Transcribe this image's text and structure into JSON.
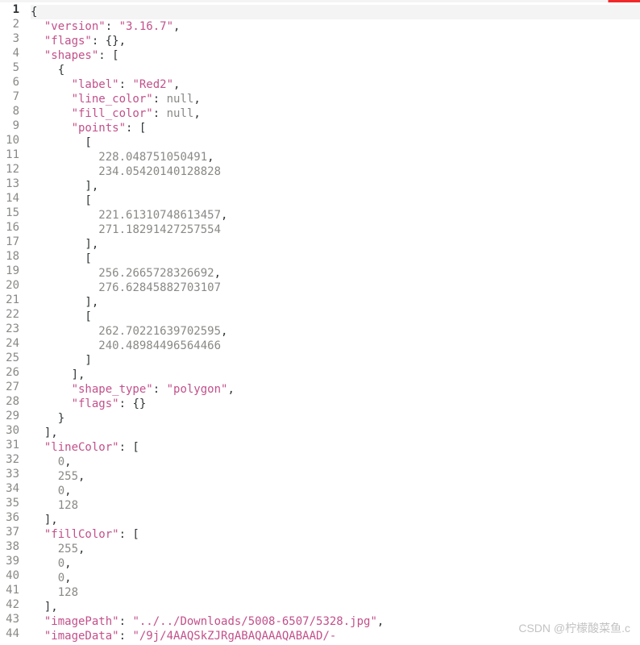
{
  "watermark": "CSDN @柠檬酸菜鱼.c",
  "lines": [
    {
      "n": 1,
      "cur": true,
      "tokens": [
        {
          "c": "p",
          "t": "{"
        }
      ]
    },
    {
      "n": 2,
      "tokens": [
        {
          "c": "p",
          "t": "  "
        },
        {
          "c": "k",
          "t": "\"version\""
        },
        {
          "c": "p",
          "t": ": "
        },
        {
          "c": "s",
          "t": "\"3.16.7\""
        },
        {
          "c": "p",
          "t": ","
        }
      ]
    },
    {
      "n": 3,
      "tokens": [
        {
          "c": "p",
          "t": "  "
        },
        {
          "c": "k",
          "t": "\"flags\""
        },
        {
          "c": "p",
          "t": ": {},"
        }
      ]
    },
    {
      "n": 4,
      "tokens": [
        {
          "c": "p",
          "t": "  "
        },
        {
          "c": "k",
          "t": "\"shapes\""
        },
        {
          "c": "p",
          "t": ": ["
        }
      ]
    },
    {
      "n": 5,
      "tokens": [
        {
          "c": "p",
          "t": "    {"
        }
      ]
    },
    {
      "n": 6,
      "tokens": [
        {
          "c": "p",
          "t": "      "
        },
        {
          "c": "k",
          "t": "\"label\""
        },
        {
          "c": "p",
          "t": ": "
        },
        {
          "c": "s",
          "t": "\"Red2\""
        },
        {
          "c": "p",
          "t": ","
        }
      ]
    },
    {
      "n": 7,
      "tokens": [
        {
          "c": "p",
          "t": "      "
        },
        {
          "c": "k",
          "t": "\"line_color\""
        },
        {
          "c": "p",
          "t": ": "
        },
        {
          "c": "n",
          "t": "null"
        },
        {
          "c": "p",
          "t": ","
        }
      ]
    },
    {
      "n": 8,
      "tokens": [
        {
          "c": "p",
          "t": "      "
        },
        {
          "c": "k",
          "t": "\"fill_color\""
        },
        {
          "c": "p",
          "t": ": "
        },
        {
          "c": "n",
          "t": "null"
        },
        {
          "c": "p",
          "t": ","
        }
      ]
    },
    {
      "n": 9,
      "tokens": [
        {
          "c": "p",
          "t": "      "
        },
        {
          "c": "k",
          "t": "\"points\""
        },
        {
          "c": "p",
          "t": ": ["
        }
      ]
    },
    {
      "n": 10,
      "tokens": [
        {
          "c": "p",
          "t": "        ["
        }
      ]
    },
    {
      "n": 11,
      "tokens": [
        {
          "c": "p",
          "t": "          "
        },
        {
          "c": "num",
          "t": "228.048751050491"
        },
        {
          "c": "p",
          "t": ","
        }
      ]
    },
    {
      "n": 12,
      "tokens": [
        {
          "c": "p",
          "t": "          "
        },
        {
          "c": "num",
          "t": "234.05420140128828"
        }
      ]
    },
    {
      "n": 13,
      "tokens": [
        {
          "c": "p",
          "t": "        ],"
        }
      ]
    },
    {
      "n": 14,
      "tokens": [
        {
          "c": "p",
          "t": "        ["
        }
      ]
    },
    {
      "n": 15,
      "tokens": [
        {
          "c": "p",
          "t": "          "
        },
        {
          "c": "num",
          "t": "221.61310748613457"
        },
        {
          "c": "p",
          "t": ","
        }
      ]
    },
    {
      "n": 16,
      "tokens": [
        {
          "c": "p",
          "t": "          "
        },
        {
          "c": "num",
          "t": "271.18291427257554"
        }
      ]
    },
    {
      "n": 17,
      "tokens": [
        {
          "c": "p",
          "t": "        ],"
        }
      ]
    },
    {
      "n": 18,
      "tokens": [
        {
          "c": "p",
          "t": "        ["
        }
      ]
    },
    {
      "n": 19,
      "tokens": [
        {
          "c": "p",
          "t": "          "
        },
        {
          "c": "num",
          "t": "256.2665728326692"
        },
        {
          "c": "p",
          "t": ","
        }
      ]
    },
    {
      "n": 20,
      "tokens": [
        {
          "c": "p",
          "t": "          "
        },
        {
          "c": "num",
          "t": "276.62845882703107"
        }
      ]
    },
    {
      "n": 21,
      "tokens": [
        {
          "c": "p",
          "t": "        ],"
        }
      ]
    },
    {
      "n": 22,
      "tokens": [
        {
          "c": "p",
          "t": "        ["
        }
      ]
    },
    {
      "n": 23,
      "tokens": [
        {
          "c": "p",
          "t": "          "
        },
        {
          "c": "num",
          "t": "262.70221639702595"
        },
        {
          "c": "p",
          "t": ","
        }
      ]
    },
    {
      "n": 24,
      "tokens": [
        {
          "c": "p",
          "t": "          "
        },
        {
          "c": "num",
          "t": "240.48984496564466"
        }
      ]
    },
    {
      "n": 25,
      "tokens": [
        {
          "c": "p",
          "t": "        ]"
        }
      ]
    },
    {
      "n": 26,
      "tokens": [
        {
          "c": "p",
          "t": "      ],"
        }
      ]
    },
    {
      "n": 27,
      "tokens": [
        {
          "c": "p",
          "t": "      "
        },
        {
          "c": "k",
          "t": "\"shape_type\""
        },
        {
          "c": "p",
          "t": ": "
        },
        {
          "c": "s",
          "t": "\"polygon\""
        },
        {
          "c": "p",
          "t": ","
        }
      ]
    },
    {
      "n": 28,
      "tokens": [
        {
          "c": "p",
          "t": "      "
        },
        {
          "c": "k",
          "t": "\"flags\""
        },
        {
          "c": "p",
          "t": ": {}"
        }
      ]
    },
    {
      "n": 29,
      "tokens": [
        {
          "c": "p",
          "t": "    }"
        }
      ]
    },
    {
      "n": 30,
      "tokens": [
        {
          "c": "p",
          "t": "  ],"
        }
      ]
    },
    {
      "n": 31,
      "tokens": [
        {
          "c": "p",
          "t": "  "
        },
        {
          "c": "k",
          "t": "\"lineColor\""
        },
        {
          "c": "p",
          "t": ": ["
        }
      ]
    },
    {
      "n": 32,
      "tokens": [
        {
          "c": "p",
          "t": "    "
        },
        {
          "c": "num",
          "t": "0"
        },
        {
          "c": "p",
          "t": ","
        }
      ]
    },
    {
      "n": 33,
      "tokens": [
        {
          "c": "p",
          "t": "    "
        },
        {
          "c": "num",
          "t": "255"
        },
        {
          "c": "p",
          "t": ","
        }
      ]
    },
    {
      "n": 34,
      "tokens": [
        {
          "c": "p",
          "t": "    "
        },
        {
          "c": "num",
          "t": "0"
        },
        {
          "c": "p",
          "t": ","
        }
      ]
    },
    {
      "n": 35,
      "tokens": [
        {
          "c": "p",
          "t": "    "
        },
        {
          "c": "num",
          "t": "128"
        }
      ]
    },
    {
      "n": 36,
      "tokens": [
        {
          "c": "p",
          "t": "  ],"
        }
      ]
    },
    {
      "n": 37,
      "tokens": [
        {
          "c": "p",
          "t": "  "
        },
        {
          "c": "k",
          "t": "\"fillColor\""
        },
        {
          "c": "p",
          "t": ": ["
        }
      ]
    },
    {
      "n": 38,
      "tokens": [
        {
          "c": "p",
          "t": "    "
        },
        {
          "c": "num",
          "t": "255"
        },
        {
          "c": "p",
          "t": ","
        }
      ]
    },
    {
      "n": 39,
      "tokens": [
        {
          "c": "p",
          "t": "    "
        },
        {
          "c": "num",
          "t": "0"
        },
        {
          "c": "p",
          "t": ","
        }
      ]
    },
    {
      "n": 40,
      "tokens": [
        {
          "c": "p",
          "t": "    "
        },
        {
          "c": "num",
          "t": "0"
        },
        {
          "c": "p",
          "t": ","
        }
      ]
    },
    {
      "n": 41,
      "tokens": [
        {
          "c": "p",
          "t": "    "
        },
        {
          "c": "num",
          "t": "128"
        }
      ]
    },
    {
      "n": 42,
      "tokens": [
        {
          "c": "p",
          "t": "  ],"
        }
      ]
    },
    {
      "n": 43,
      "tokens": [
        {
          "c": "p",
          "t": "  "
        },
        {
          "c": "k",
          "t": "\"imagePath\""
        },
        {
          "c": "p",
          "t": ": "
        },
        {
          "c": "s",
          "t": "\"../../Downloads/5008-6507/5328.jpg\""
        },
        {
          "c": "p",
          "t": ","
        }
      ]
    },
    {
      "n": 44,
      "tokens": [
        {
          "c": "p",
          "t": "  "
        },
        {
          "c": "k",
          "t": "\"imageData\""
        },
        {
          "c": "p",
          "t": ": "
        },
        {
          "c": "s",
          "t": "\"/9j/4AAQSkZJRgABAQAAAQABAAD/-"
        }
      ]
    }
  ]
}
